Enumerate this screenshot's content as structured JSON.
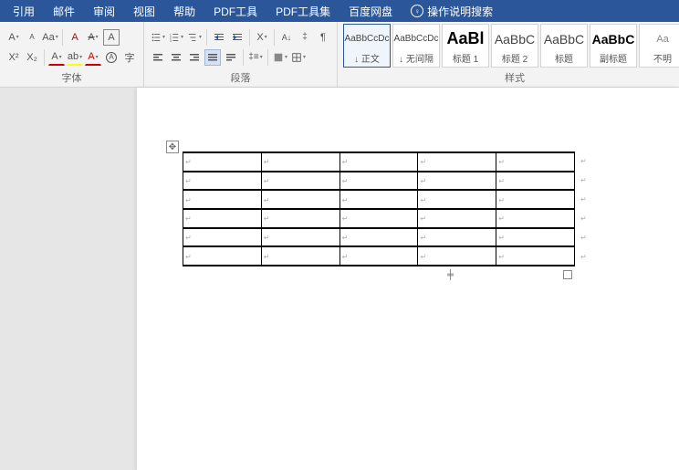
{
  "menubar": {
    "items": [
      "引用",
      "邮件",
      "审阅",
      "视图",
      "帮助",
      "PDF工具",
      "PDF工具集",
      "百度网盘"
    ],
    "tell_me": "操作说明搜索"
  },
  "ribbon": {
    "font": {
      "label": "字体",
      "row1": {
        "grow": "A",
        "shrink": "A",
        "case": "Aa",
        "phonetic": "A",
        "clear": "A",
        "border": "A"
      },
      "row2": {
        "super": "X²",
        "sub": "X₂",
        "font_color": "A",
        "highlight": "ab",
        "char_shading": "A",
        "enclose": "A",
        "char_border": "字"
      }
    },
    "paragraph": {
      "label": "段落",
      "row1": {
        "bullets": "•",
        "numbering": "1",
        "multilevel": "≡",
        "dec_indent": "≡",
        "inc_indent": "≡",
        "sort": "A↓",
        "asian": "X",
        "line_spacing": "‡",
        "show_marks": "¶"
      },
      "row2": {
        "align_left": "≡",
        "align_center": "≡",
        "align_right": "≡",
        "justify": "≡",
        "distribute": "≡",
        "shading": "▦",
        "borders": "⊞"
      }
    },
    "styles": {
      "label": "样式",
      "items": [
        {
          "preview": "AaBbCcDc",
          "name": "↓ 正文",
          "size": "10px",
          "color": "#444"
        },
        {
          "preview": "AaBbCcDc",
          "name": "↓ 无间隔",
          "size": "10px",
          "color": "#444"
        },
        {
          "preview": "AaBl",
          "name": "标题 1",
          "size": "18px",
          "color": "#000",
          "weight": "600"
        },
        {
          "preview": "AaBbC",
          "name": "标题 2",
          "size": "14px",
          "color": "#444"
        },
        {
          "preview": "AaBbC",
          "name": "标题",
          "size": "14px",
          "color": "#444"
        },
        {
          "preview": "AaBbC",
          "name": "副标题",
          "size": "14px",
          "color": "#000",
          "weight": "600"
        },
        {
          "preview": "Aa",
          "name": "不明",
          "size": "11px",
          "color": "#888"
        }
      ]
    }
  },
  "document": {
    "table": {
      "rows": 6,
      "cols": 5
    }
  }
}
